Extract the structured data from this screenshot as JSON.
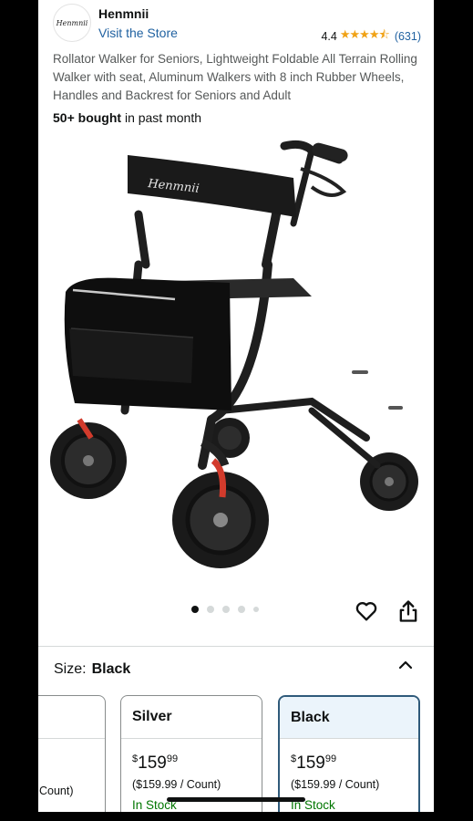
{
  "header": {
    "logo_text": "Henmnii",
    "brand": "Henmnii",
    "visit_store": "Visit the Store",
    "rating": "4.4",
    "stars": "★★★★⯪",
    "review_count": "(631)"
  },
  "product": {
    "title": "Rollator Walker for Seniors, Lightweight Foldable All Terrain Rolling Walker with seat, Aluminum Walkers with 8 inch Rubber Wheels, Handles and Backrest for Seniors and Adult",
    "bought_bold": "50+ bought",
    "bought_rest": " in past month",
    "backrest_logo": "Henmnii",
    "image_count": 5,
    "current_image": 1
  },
  "size": {
    "label": "Size:",
    "value": "Black"
  },
  "options": [
    {
      "name": "",
      "price_dollars": "",
      "price_cents": "",
      "unit": "Count)",
      "stock": ""
    },
    {
      "name": "Silver",
      "price_dollars": "159",
      "price_cents": "99",
      "unit": "($159.99 / Count)",
      "stock": "In Stock"
    },
    {
      "name": "Black",
      "price_dollars": "159",
      "price_cents": "99",
      "unit": "($159.99 / Count)",
      "stock": "In Stock"
    }
  ],
  "colors": {
    "link": "#2162a1",
    "star": "#f0a215",
    "in_stock": "#007600",
    "selected_border": "#2f5a7a",
    "selected_head": "#ebf4fb",
    "accent_red": "#d23b2c"
  },
  "icons": [
    "heart-icon",
    "share-icon",
    "chevron-up-icon"
  ]
}
